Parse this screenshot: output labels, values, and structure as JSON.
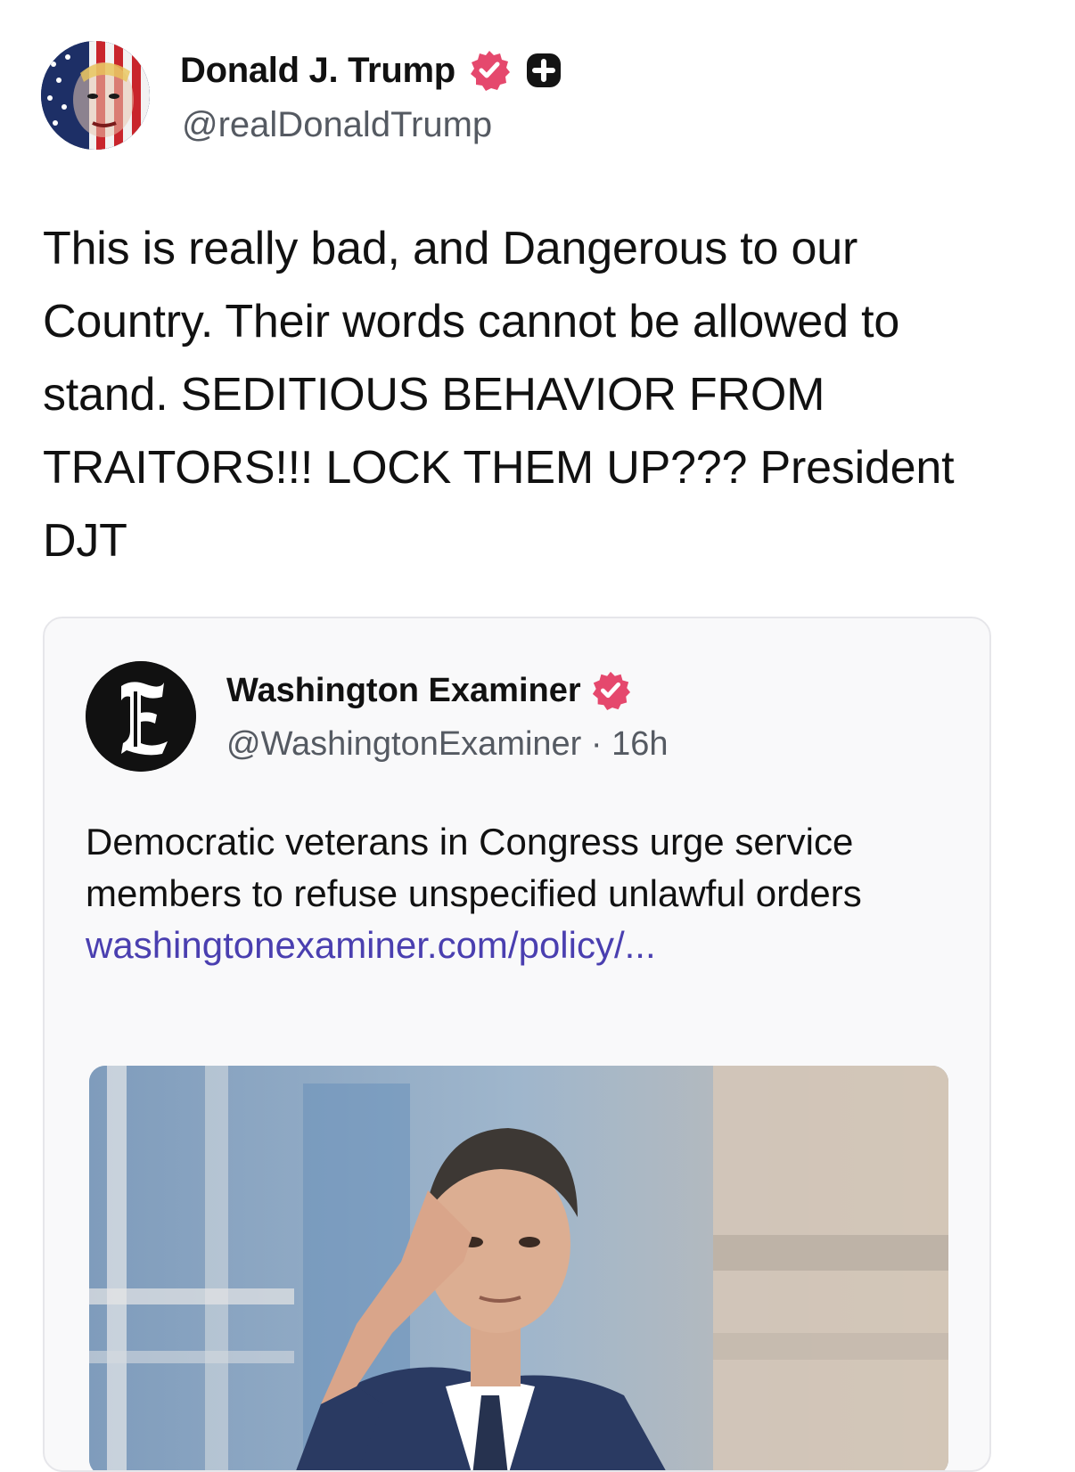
{
  "post": {
    "author": {
      "name": "Donald J. Trump",
      "handle": "@realDonaldTrump",
      "avatar": "flag-painted-portrait",
      "verified_icon": "verified-badge-icon",
      "plus_icon": "plus-badge-icon"
    },
    "text": "This is really bad, and Dangerous to our Country. Their words cannot be allowed to stand. SEDITIOUS BEHAVIOR FROM TRAITORS!!! LOCK THEM UP??? President DJT"
  },
  "quoted": {
    "author": {
      "name": "Washington Examiner",
      "handle": "@WashingtonExaminer",
      "time": "16h",
      "separator": " · ",
      "logo": "gothic-E-logo"
    },
    "text": "Democratic veterans in Congress urge service members to refuse unspecified unlawful orders",
    "link": "washingtonexaminer.com/policy/...",
    "image": "man-in-suit-saluting-photo"
  },
  "colors": {
    "verified": "#e5486d",
    "link": "#4a3fb0",
    "muted_text": "#555a62",
    "card_border": "#e6e6ea",
    "card_bg": "#f9f9fa"
  }
}
